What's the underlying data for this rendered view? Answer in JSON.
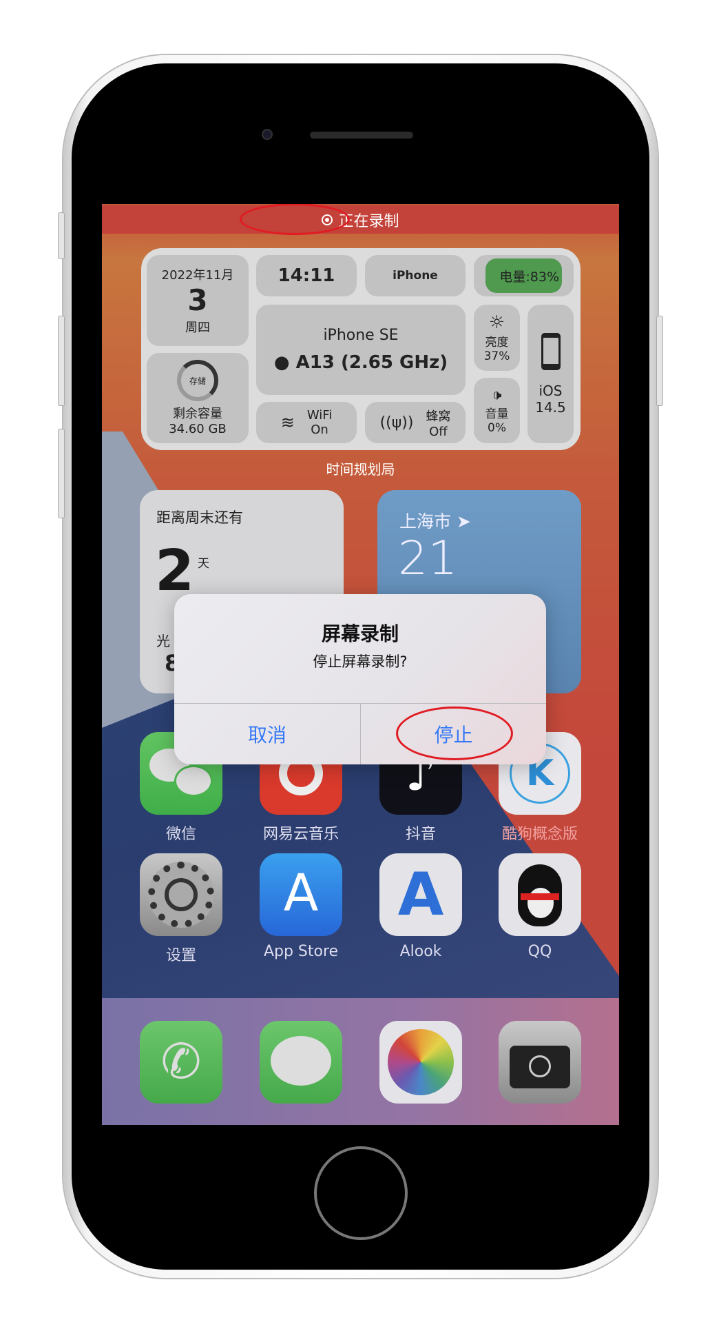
{
  "status_bar": {
    "recording_label": "正在录制",
    "recording_color": "#c3423a"
  },
  "device_widget": {
    "date": {
      "year_month": "2022年11月",
      "day": "3",
      "weekday": "周四"
    },
    "time": "14:11",
    "device_name": "iPhone",
    "battery": {
      "label": "电量:83%",
      "percent": 83,
      "color": "#4f9a4f"
    },
    "model": "iPhone SE",
    "chip": "A13 (2.65 GHz)",
    "storage": {
      "ring_label": "存储",
      "label": "剩余容量",
      "value": "34.60 GB"
    },
    "wifi": {
      "label": "WiFi",
      "value": "On"
    },
    "cellular": {
      "label": "蜂窝",
      "value": "Off"
    },
    "brightness": {
      "label": "亮度",
      "value": "37%"
    },
    "volume": {
      "label": "音量",
      "value": "0%"
    },
    "os": {
      "name": "iOS",
      "version": "14.5"
    },
    "app_label": "时间规划局"
  },
  "weekend_widget": {
    "title": "距离周末还有",
    "days": "2",
    "unit": "天",
    "sub_label": "光",
    "sub_value": "8"
  },
  "weather_widget": {
    "city": "上海市",
    "temp": "21"
  },
  "alert": {
    "title": "屏幕录制",
    "message": "停止屏幕录制?",
    "cancel": "取消",
    "stop": "停止",
    "button_color": "#3478f6"
  },
  "apps": [
    {
      "label": "微信",
      "icon": "wechat-icon"
    },
    {
      "label": "网易云音乐",
      "icon": "netease-music-icon"
    },
    {
      "label": "抖音",
      "icon": "douyin-icon"
    },
    {
      "label": "酷狗概念版",
      "icon": "kugou-icon"
    },
    {
      "label": "设置",
      "icon": "settings-icon"
    },
    {
      "label": "App Store",
      "icon": "app-store-icon"
    },
    {
      "label": "Alook",
      "icon": "alook-icon"
    },
    {
      "label": "QQ",
      "icon": "qq-icon"
    }
  ],
  "dock": [
    {
      "icon": "phone-icon"
    },
    {
      "icon": "messages-icon"
    },
    {
      "icon": "photos-icon"
    },
    {
      "icon": "camera-icon"
    }
  ]
}
